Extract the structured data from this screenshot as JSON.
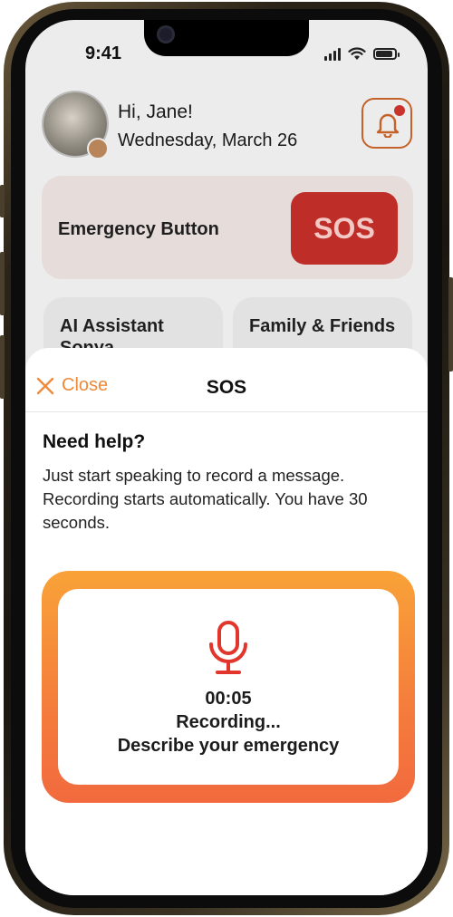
{
  "status_bar": {
    "time": "9:41"
  },
  "home": {
    "greeting": "Hi, Jane!",
    "date": "Wednesday, March 26",
    "emergency_card": {
      "label": "Emergency Button",
      "sos_label": "SOS"
    },
    "tiles": [
      {
        "label": "AI Assistant Sonya"
      },
      {
        "label": "Family & Friends"
      }
    ]
  },
  "sheet": {
    "close_label": "Close",
    "title": "SOS",
    "help_title": "Need help?",
    "help_text": "Just start speaking to record a message. Recording starts automatically. You have 30 seconds.",
    "recording": {
      "timer": "00:05",
      "status": "Recording...",
      "prompt": "Describe your emergency"
    }
  },
  "colors": {
    "accent_orange": "#ee8a3a",
    "sos_red": "#bf2d28",
    "mic_red": "#e2352b",
    "gradient_top": "#f9a238",
    "gradient_bottom": "#f26a3e"
  },
  "icons": [
    "signal-icon",
    "wifi-icon",
    "battery-icon",
    "bell-icon",
    "close-icon",
    "microphone-icon"
  ]
}
